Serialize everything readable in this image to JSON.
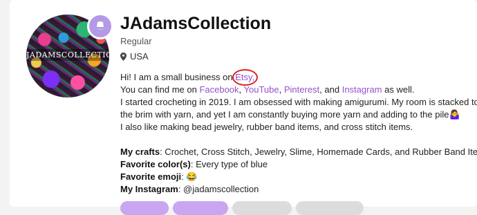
{
  "profile": {
    "avatar_text": "JADAMSCOLLECTION",
    "name": "JAdamsCollection",
    "trust_level": "Regular",
    "location": "USA",
    "badge_icon": "cowboy-hat-icon"
  },
  "bio": {
    "line1_text": "Hi! I am a small business on ",
    "etsy": "Etsy,",
    "line2_text": "You can find me on ",
    "facebook": "Facebook",
    "comma1": ", ",
    "youtube": "YouTube",
    "comma2": ", ",
    "pinterest": "Pinterest",
    "and": ", and ",
    "instagram": "Instagram",
    "as_well": " as well.",
    "line3": "I started crocheting in 2019. I am obsessed with making amigurumi. My room is stacked to",
    "line4": "the brim with yarn, and yet I am constantly buying more yarn and adding to the pile🤷‍♀️",
    "line5": "I also like making bead jewelry, rubber band items, and cross stitch items.",
    "crafts_label": "My crafts",
    "crafts_value": ": Crochet, Cross Stitch, Jewelry, Slime, Homemade Cards, and Rubber Band Items.",
    "color_label": "Favorite color(s)",
    "color_value": ": Every type of blue",
    "emoji_label": "Favorite emoji",
    "emoji_value": ": 😂",
    "instagram_label": "My Instagram",
    "instagram_value": ": @jadamscollection"
  },
  "colors": {
    "link": "#9352c9",
    "badge": "#b399e6",
    "annotation": "#e02020",
    "tab_active": "#c9a6f0",
    "tab_inactive": "#dcdcdc"
  },
  "tabs": [
    {
      "color": "#c9a6f0"
    },
    {
      "color": "#c9a6f0"
    },
    {
      "color": "#dcdcdc"
    },
    {
      "color": "#dcdcdc"
    }
  ]
}
